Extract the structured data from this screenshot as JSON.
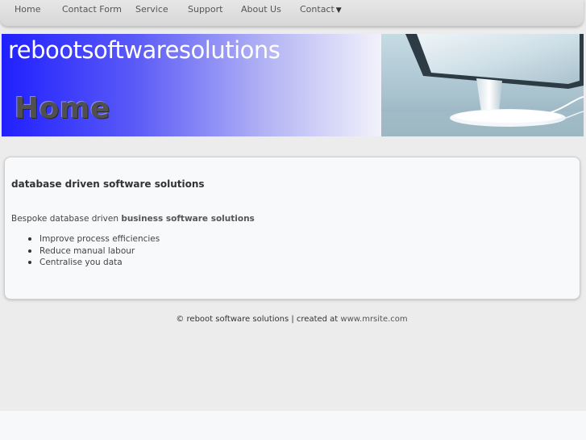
{
  "nav": {
    "items": [
      {
        "label": "Home"
      },
      {
        "label": "Contact Form"
      },
      {
        "label": "Service"
      },
      {
        "label": "Support"
      },
      {
        "label": "About Us"
      },
      {
        "label": "Contact"
      }
    ],
    "dropdown_glyph": "▼"
  },
  "banner": {
    "site_title": "rebootsoftwaresolutions",
    "page_heading": "Home"
  },
  "content": {
    "heading": "database driven software solutions",
    "intro_prefix": "Bespoke database driven ",
    "intro_bold": "business software solutions",
    "bullets": [
      "Improve process efficiencies",
      "Reduce manual labour",
      "Centralise you data"
    ]
  },
  "footer": {
    "text": "© reboot software solutions | created at ",
    "link": "www.mrsite.com"
  },
  "colors": {
    "banner_gradient_start": "#2020ff",
    "banner_gradient_end": "#f2f2fb",
    "page_background": "#ececec",
    "content_background": "#f8f9fa"
  }
}
